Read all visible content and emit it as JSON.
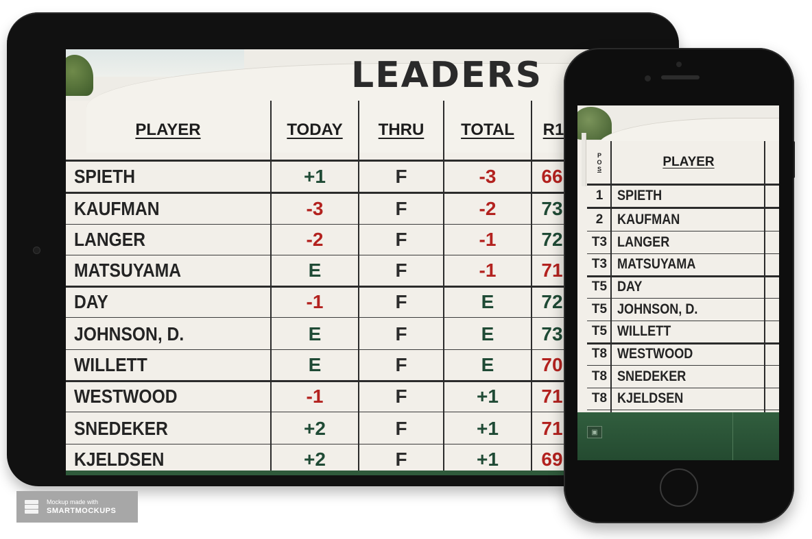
{
  "tablet": {
    "title": "LEADERS",
    "headers": {
      "player": "PLAYER",
      "today": "TODAY",
      "thru": "THRU",
      "total": "TOTAL",
      "r1": "R1"
    },
    "rows": [
      {
        "player": "SPIETH",
        "today": "+1",
        "today_color": "green",
        "thru": "F",
        "total": "-3",
        "total_color": "red",
        "r1": "66",
        "r1_color": "red"
      },
      {
        "player": "KAUFMAN",
        "today": "-3",
        "today_color": "red",
        "thru": "F",
        "total": "-2",
        "total_color": "red",
        "r1": "73",
        "r1_color": "green"
      },
      {
        "player": "LANGER",
        "today": "-2",
        "today_color": "red",
        "thru": "F",
        "total": "-1",
        "total_color": "red",
        "r1": "72",
        "r1_color": "green"
      },
      {
        "player": "MATSUYAMA",
        "today": "E",
        "today_color": "green",
        "thru": "F",
        "total": "-1",
        "total_color": "red",
        "r1": "71",
        "r1_color": "red"
      },
      {
        "player": "DAY",
        "today": "-1",
        "today_color": "red",
        "thru": "F",
        "total": "E",
        "total_color": "green",
        "r1": "72",
        "r1_color": "green"
      },
      {
        "player": "JOHNSON, D.",
        "today": "E",
        "today_color": "green",
        "thru": "F",
        "total": "E",
        "total_color": "green",
        "r1": "73",
        "r1_color": "green"
      },
      {
        "player": "WILLETT",
        "today": "E",
        "today_color": "green",
        "thru": "F",
        "total": "E",
        "total_color": "green",
        "r1": "70",
        "r1_color": "red"
      },
      {
        "player": "WESTWOOD",
        "today": "-1",
        "today_color": "red",
        "thru": "F",
        "total": "+1",
        "total_color": "green",
        "r1": "71",
        "r1_color": "red"
      },
      {
        "player": "SNEDEKER",
        "today": "+2",
        "today_color": "green",
        "thru": "F",
        "total": "+1",
        "total_color": "green",
        "r1": "71",
        "r1_color": "red"
      },
      {
        "player": "KJELDSEN",
        "today": "+2",
        "today_color": "green",
        "thru": "F",
        "total": "+1",
        "total_color": "green",
        "r1": "69",
        "r1_color": "red"
      }
    ]
  },
  "phone": {
    "headers": {
      "pos": [
        "P",
        "O",
        "S"
      ],
      "player": "PLAYER"
    },
    "rows": [
      {
        "pos": "1",
        "player": "SPIETH"
      },
      {
        "pos": "2",
        "player": "KAUFMAN"
      },
      {
        "pos": "T3",
        "player": "LANGER"
      },
      {
        "pos": "T3",
        "player": "MATSUYAMA"
      },
      {
        "pos": "T5",
        "player": "DAY"
      },
      {
        "pos": "T5",
        "player": "JOHNSON, D."
      },
      {
        "pos": "T5",
        "player": "WILLETT"
      },
      {
        "pos": "T8",
        "player": "WESTWOOD"
      },
      {
        "pos": "T8",
        "player": "SNEDEKER"
      },
      {
        "pos": "T8",
        "player": "KJELDSEN"
      }
    ]
  },
  "watermark": {
    "line1": "Mockup made with",
    "line2": "SMARTMOCKUPS"
  },
  "colors": {
    "red": "#b3221f",
    "green": "#1f4a35",
    "board": "#f2efe9",
    "grass": "#2f5a3b"
  },
  "icons": {
    "phone_screen_icon": "camera-icon",
    "watermark_logo": "stack-layers-icon"
  }
}
